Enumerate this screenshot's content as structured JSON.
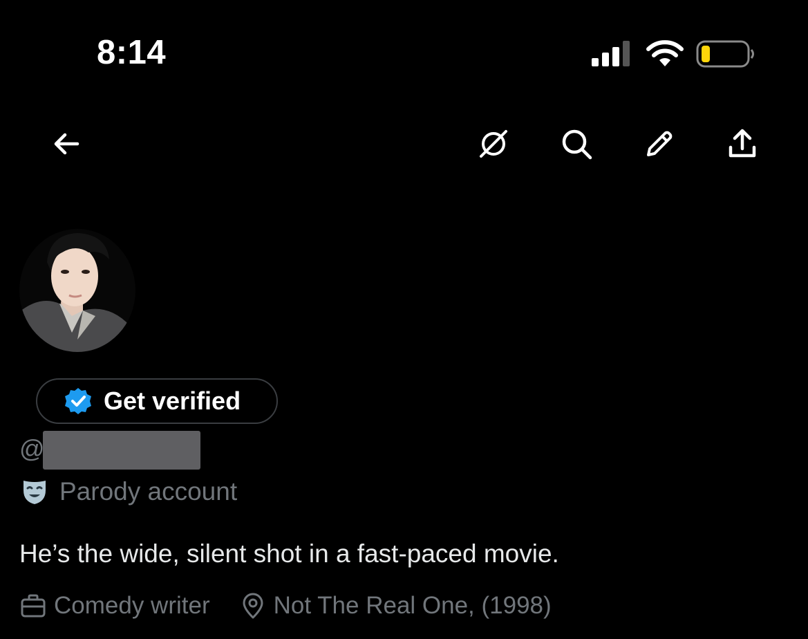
{
  "status_bar": {
    "time": "8:14",
    "icons": [
      "signal-icon",
      "wifi-icon",
      "battery-low-icon"
    ],
    "battery_color": "#ffd60a"
  },
  "nav": {
    "icons": [
      "back-arrow-icon",
      "grok-icon",
      "search-icon",
      "edit-pencil-icon",
      "share-icon"
    ]
  },
  "profile": {
    "get_verified_label": "Get verified",
    "handle_prefix": "@",
    "parody_label": "Parody account",
    "bio": "He’s the wide, silent shot in a fast-paced movie.",
    "profession": "Comedy writer",
    "location": "Not The Real One, (1998)"
  },
  "colors": {
    "verified_blue": "#1d9bf0",
    "secondary_text": "#71767b",
    "primary_text": "#e7e9ea"
  }
}
